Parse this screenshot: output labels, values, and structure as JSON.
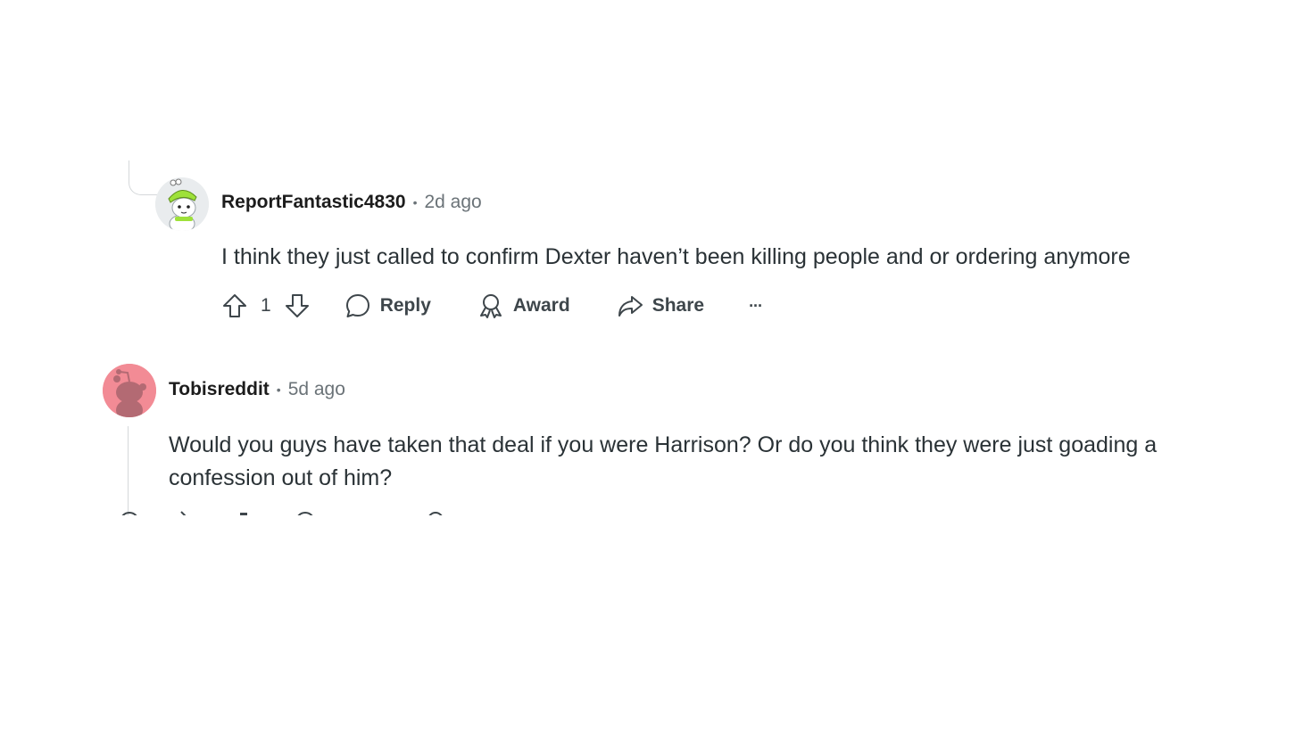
{
  "comments": [
    {
      "username": "ReportFantastic4830",
      "separator": "•",
      "time": "2d ago",
      "body": "I think they just called to confirm Dexter haven’t been killing people and or ordering anymore",
      "actions": {
        "upvote_icon": "upvote-arrow-icon",
        "vote_count": "1",
        "downvote_icon": "downvote-arrow-icon",
        "reply_label": "Reply",
        "award_label": "Award",
        "share_label": "Share",
        "more_label": "···"
      },
      "avatar": "snoo-green-hat-avatar"
    },
    {
      "username": "Tobisreddit",
      "separator": "•",
      "time": "5d ago",
      "body": "Would you guys have taken that deal if you were Harrison? Or do you think they were just goading a confession out of him?",
      "avatar": "default-snoo-pink-avatar"
    }
  ],
  "colors": {
    "text_primary": "#1c1c1c",
    "text_secondary": "#6b7378",
    "avatar_pink": "#f28b95",
    "snoo_body": "#b36a73",
    "thread_line": "#d5d8da"
  }
}
